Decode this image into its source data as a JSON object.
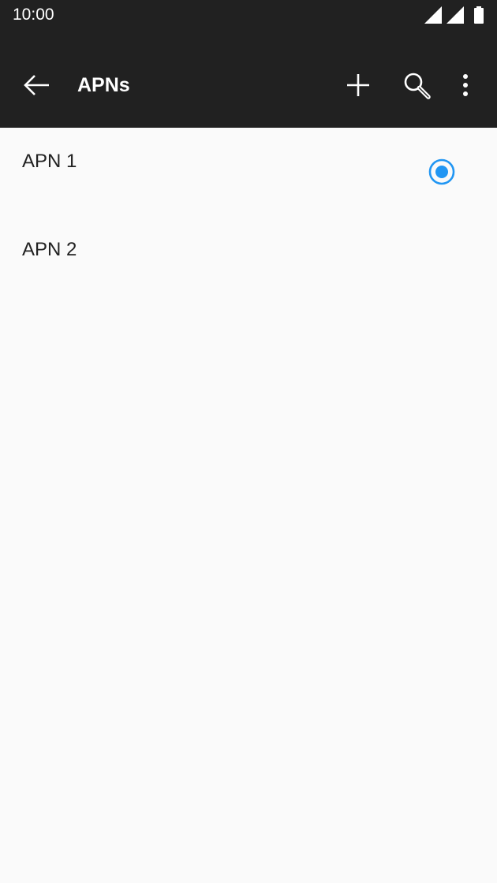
{
  "status_bar": {
    "time": "10:00",
    "icons": [
      "cell-signal-icon",
      "cell-signal-icon",
      "battery-icon"
    ]
  },
  "app_bar": {
    "title": "APNs",
    "back_icon": "arrow-left-icon",
    "actions": [
      "plus-icon",
      "search-icon",
      "more-vert-icon"
    ]
  },
  "apn_list": {
    "items": [
      {
        "name": "APN 1",
        "selected": true
      },
      {
        "name": "APN 2",
        "selected": false
      }
    ]
  },
  "colors": {
    "app_bar_bg": "#212121",
    "page_bg": "#fafafa",
    "accent": "#2196f3",
    "text_primary": "#212121"
  }
}
